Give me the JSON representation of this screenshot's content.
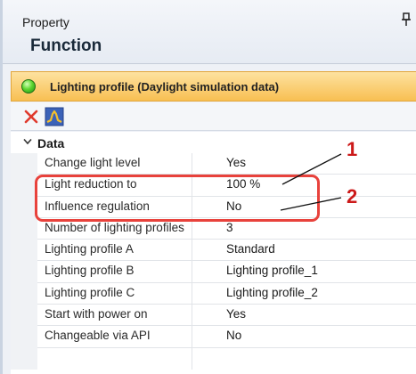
{
  "header": {
    "property_label": "Property",
    "function_label": "Function"
  },
  "profile": {
    "title": "Lighting profile (Daylight simulation data)",
    "status_color": "#3fc11f",
    "bar_color": "#f9c866"
  },
  "toolbar": {
    "delete_icon": "close-x-icon",
    "profile_icon": "lighting-profile-icon"
  },
  "group": {
    "label": "Data",
    "expanded": true
  },
  "rows": [
    {
      "name": "Change light level",
      "value": "Yes"
    },
    {
      "name": "Light reduction to",
      "value": "100 %"
    },
    {
      "name": "Influence regulation",
      "value": "No"
    },
    {
      "name": "Number of lighting profiles",
      "value": "3"
    },
    {
      "name": "Lighting profile A",
      "value": "Standard"
    },
    {
      "name": "Lighting profile B",
      "value": "Lighting profile_1"
    },
    {
      "name": "Lighting profile C",
      "value": "Lighting profile_2"
    },
    {
      "name": "Start with power on",
      "value": "Yes"
    },
    {
      "name": "Changeable via API",
      "value": "No"
    }
  ],
  "annotations": {
    "marker_1": "1",
    "marker_2": "2",
    "highlight_color": "#e8423c",
    "marker_color": "#cc1a1a"
  }
}
